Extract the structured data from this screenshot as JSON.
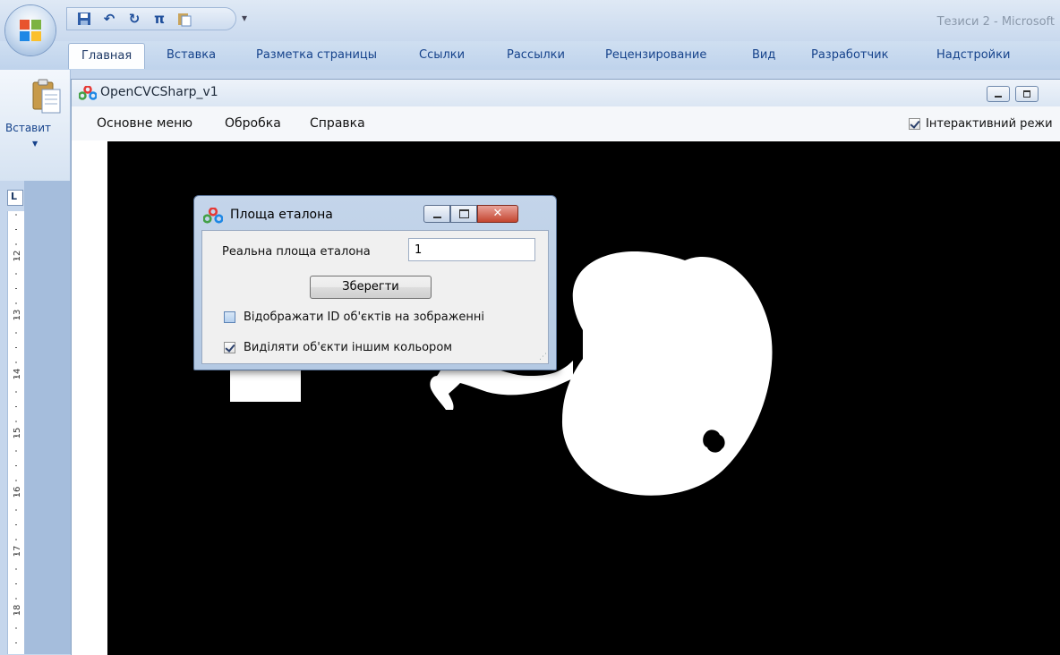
{
  "word": {
    "window_title": "Тезиси 2 - Microsoft",
    "quick_access": [
      "save-icon",
      "undo-icon",
      "redo-icon",
      "pi-icon",
      "paste-icon"
    ],
    "tabs": [
      "Главная",
      "Вставка",
      "Разметка страницы",
      "Ссылки",
      "Рассылки",
      "Рецензирование",
      "Вид",
      "Разработчик",
      "Надстройки"
    ],
    "active_tab": "Главная",
    "paste_label": "Вставит",
    "ruler_corner": "L",
    "ruler_numbers": [
      "12",
      "13",
      "14",
      "15",
      "16",
      "17",
      "18"
    ]
  },
  "cv_window": {
    "title": "OpenCVCSharp_v1",
    "menu": [
      "Основне меню",
      "Обробка",
      "Справка"
    ],
    "interactive_mode": {
      "label": "Інтерактивний режи",
      "checked": true
    }
  },
  "dialog": {
    "title": "Площа еталона",
    "area_label": "Реальна площа еталона",
    "area_value": "1",
    "save_label": "Зберегти",
    "show_ids": {
      "label": "Відображати ID об'єктів на зображенні",
      "checked": false
    },
    "highlight": {
      "label": "Виділяти об'єкти іншим кольором",
      "checked": true
    }
  },
  "colors": {
    "canvas_background": "#000000",
    "object_fill": "#ffffff",
    "word_tab_text": "#15428b"
  }
}
